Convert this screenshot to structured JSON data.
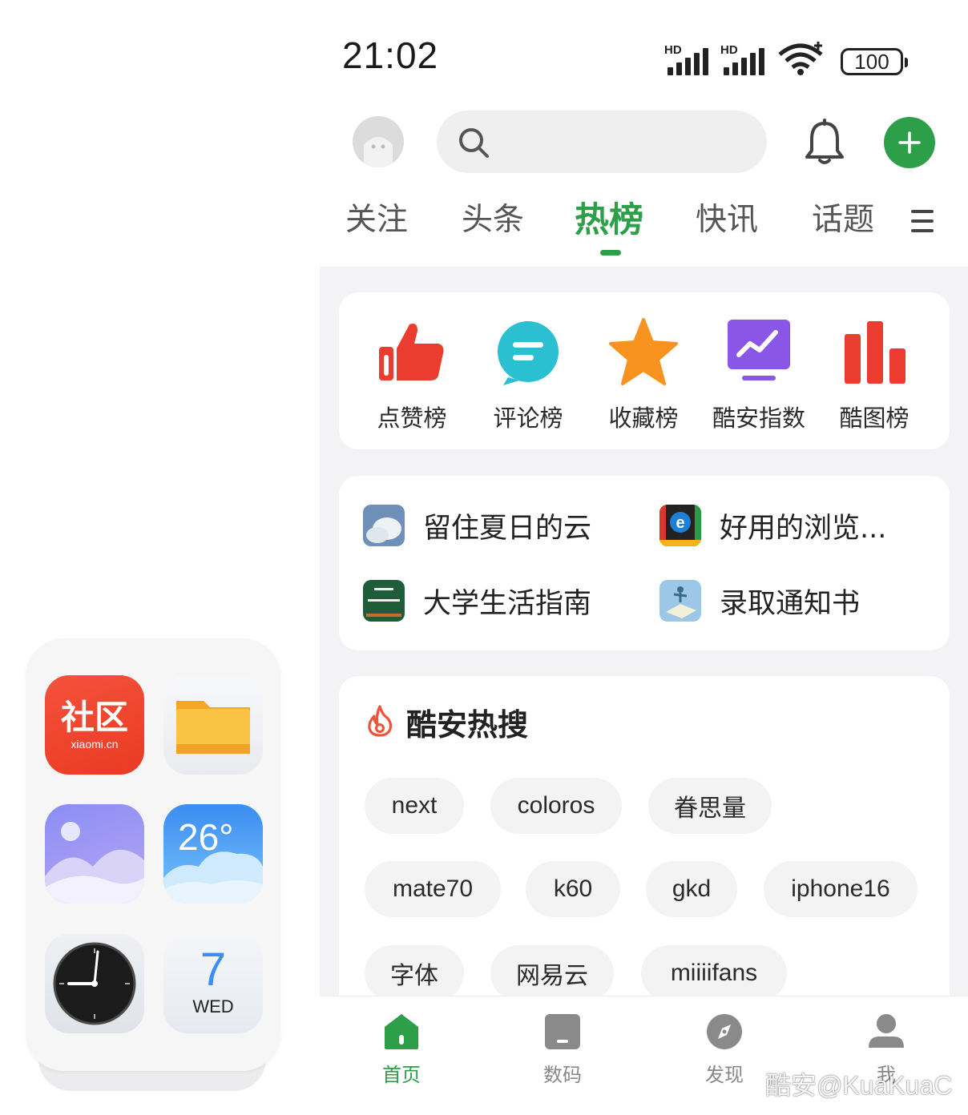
{
  "widget": {
    "community_title": "社区",
    "community_sub": "xiaomi.cn",
    "weather_temp": "26°",
    "calendar_day": "7",
    "calendar_weekday": "WED"
  },
  "status_bar": {
    "time": "21:02",
    "sim1_label": "HD",
    "sim2_label": "HD",
    "battery": "100"
  },
  "tabs": [
    {
      "label": "关注"
    },
    {
      "label": "头条"
    },
    {
      "label": "热榜",
      "active": true
    },
    {
      "label": "快讯"
    },
    {
      "label": "话题"
    }
  ],
  "ranks": [
    {
      "label": "点赞榜",
      "icon": "thumbs-up-icon"
    },
    {
      "label": "评论榜",
      "icon": "comment-icon"
    },
    {
      "label": "收藏榜",
      "icon": "star-icon"
    },
    {
      "label": "酷安指数",
      "icon": "trend-chart-icon"
    },
    {
      "label": "酷图榜",
      "icon": "bar-chart-icon"
    }
  ],
  "topics": [
    {
      "name": "留住夏日的云"
    },
    {
      "name": "好用的浏览..."
    },
    {
      "name": "大学生活指南",
      "thumb_text": "大学 生活指南"
    },
    {
      "name": "录取通知书"
    }
  ],
  "hot_search": {
    "title": "酷安热搜",
    "chips": [
      "next",
      "coloros",
      "眷思量",
      "mate70",
      "k60",
      "gkd",
      "iphone16",
      "字体",
      "网易云",
      "miiiifans"
    ]
  },
  "bottom_nav": [
    {
      "label": "首页",
      "active": true
    },
    {
      "label": "数码"
    },
    {
      "label": "发现"
    },
    {
      "label": "我"
    }
  ],
  "watermark": "酷安@KuaKuaC",
  "colors": {
    "accent": "#2c9f48",
    "feed_bg": "#f3f3f5"
  }
}
